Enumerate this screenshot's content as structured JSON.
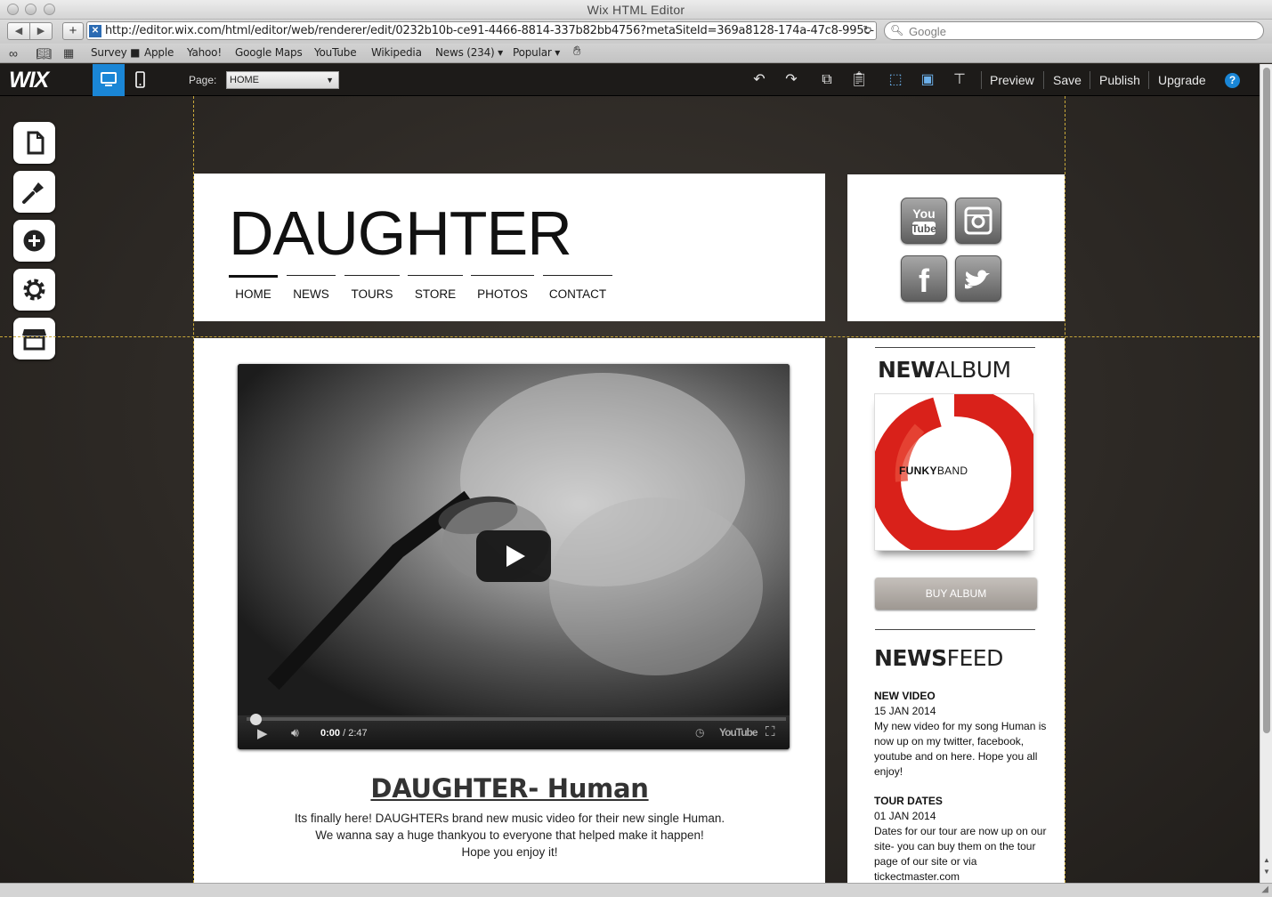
{
  "window": {
    "title": "Wix HTML Editor"
  },
  "browser": {
    "back_icon": "back-arrow-icon",
    "forward_icon": "forward-arrow-icon",
    "add_label": "+",
    "url": "http://editor.wix.com/html/editor/web/renderer/edit/0232b10b-ce91-4466-8814-337b82bb4756?metaSiteId=369a8128-174a-47c8-995c-",
    "search_placeholder": "Google",
    "bookmarks": [
      "Survey",
      "Apple",
      "Yahoo!",
      "Google Maps",
      "YouTube",
      "Wikipedia",
      "News (234)",
      "Popular"
    ]
  },
  "editor": {
    "logo": "WIX",
    "page_label": "Page:",
    "page_value": "HOME",
    "actions": {
      "preview": "Preview",
      "save": "Save",
      "publish": "Publish",
      "upgrade": "Upgrade",
      "help": "?"
    },
    "sidebar": [
      "pages-icon",
      "design-icon",
      "add-icon",
      "settings-icon",
      "app-market-icon"
    ],
    "accent": "#1a86d6"
  },
  "site": {
    "title": "DAUGHTER",
    "menu": [
      "HOME",
      "NEWS",
      "TOURS",
      "STORE",
      "PHOTOS",
      "CONTACT"
    ],
    "social": [
      "YouTube",
      "Instagram",
      "Facebook",
      "Twitter"
    ],
    "video": {
      "time_current": "0:00",
      "time_total": "/ 2:47",
      "progress": 0
    },
    "post_title": "DAUGHTER- Human",
    "post_lines": [
      "Its finally here! DAUGHTERs brand new music video for their new single Human.",
      "We wanna say a huge thankyou to everyone that helped make it happen!",
      "Hope you enjoy it!"
    ],
    "album_head_bold": "NEW",
    "album_head_rest": "ALBUM",
    "album_text_bold": "FUNKY",
    "album_text_rest": "BAND",
    "buy_label": "BUY ALBUM",
    "feed_head_bold": "NEWS",
    "feed_head_rest": "FEED",
    "news": [
      {
        "title": "NEW VIDEO",
        "date": "15 JAN 2014",
        "text": "My new video for my song Human is now up on my twitter, facebook, youtube and on here. Hope you all enjoy!"
      },
      {
        "title": "TOUR DATES",
        "date": "01 JAN 2014",
        "text": "Dates for our tour are now up on our site- you can buy them on the tour page of our site or via tickectmaster.com"
      }
    ]
  }
}
